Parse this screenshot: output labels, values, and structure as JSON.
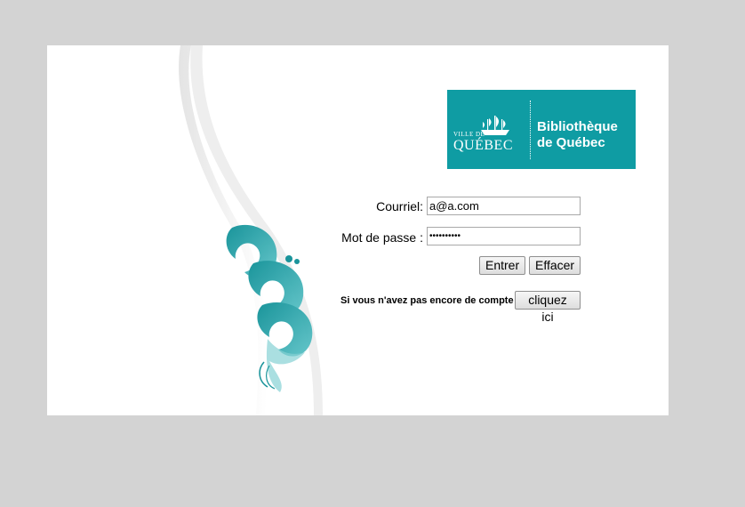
{
  "logo": {
    "city_small": "VILLE DE",
    "city_name": "QUÉBEC",
    "library_line1": "Bibliothèque",
    "library_line2": "de Québec"
  },
  "form": {
    "email_label": "Courriel:",
    "email_value": "a@a.com",
    "password_label": "Mot de passe :",
    "password_value": "••••••••••",
    "submit_label": "Entrer",
    "clear_label": "Effacer"
  },
  "signup": {
    "prompt": "Si vous n'avez pas encore de compte :",
    "button_label": "cliquez ici"
  },
  "colors": {
    "page_background": "#d3d3d3",
    "panel_background": "#ffffff",
    "brand_teal": "#0f9ca3"
  }
}
